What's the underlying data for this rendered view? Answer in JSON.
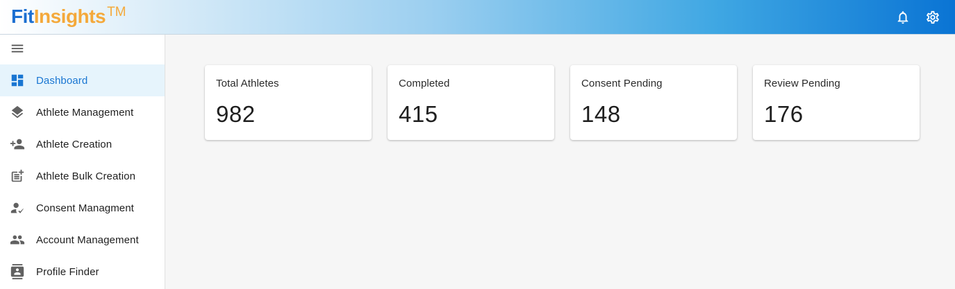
{
  "app": {
    "logo_fit": "Fit",
    "logo_insights": "Insights",
    "logo_tm": "TM"
  },
  "header": {
    "notifications_icon": "bell-icon",
    "settings_icon": "gear-icon"
  },
  "sidebar": {
    "menu_icon": "hamburger-menu-icon",
    "items": [
      {
        "label": "Dashboard",
        "icon": "dashboard-icon",
        "active": true
      },
      {
        "label": "Athlete Management",
        "icon": "layers-icon",
        "active": false
      },
      {
        "label": "Athlete Creation",
        "icon": "person-add-icon",
        "active": false
      },
      {
        "label": "Athlete Bulk Creation",
        "icon": "post-add-icon",
        "active": false
      },
      {
        "label": "Consent Managment",
        "icon": "person-check-icon",
        "active": false
      },
      {
        "label": "Account Management",
        "icon": "group-icon",
        "active": false
      },
      {
        "label": "Profile Finder",
        "icon": "contact-card-icon",
        "active": false
      }
    ]
  },
  "stats": [
    {
      "title": "Total Athletes",
      "value": "982"
    },
    {
      "title": "Completed",
      "value": "415"
    },
    {
      "title": "Consent Pending",
      "value": "148"
    },
    {
      "title": "Review Pending",
      "value": "176"
    }
  ],
  "colors": {
    "accent": "#1976d2",
    "active_bg": "#e6f4fc",
    "logo_blue": "#1c6fd1",
    "logo_orange": "#f4a93b"
  }
}
